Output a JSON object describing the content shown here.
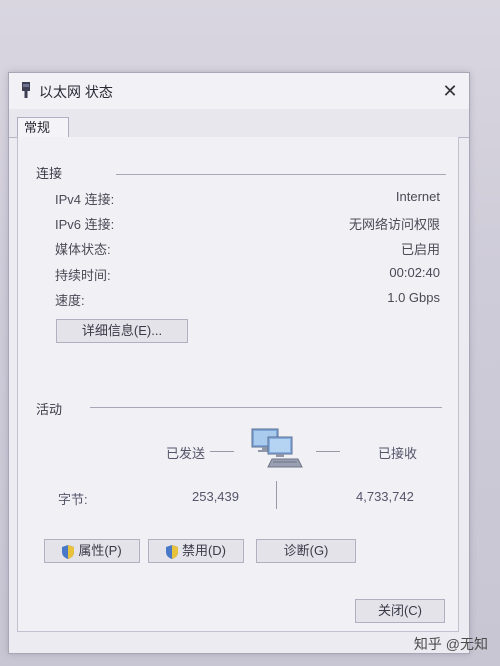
{
  "window": {
    "title": "以太网 状态",
    "close_glyph": "✕"
  },
  "tabs": [
    {
      "label": "常规"
    }
  ],
  "connection": {
    "section_title": "连接",
    "rows": [
      {
        "label": "IPv4 连接:",
        "value": "Internet"
      },
      {
        "label": "IPv6 连接:",
        "value": "无网络访问权限"
      },
      {
        "label": "媒体状态:",
        "value": "已启用"
      },
      {
        "label": "持续时间:",
        "value": "00:02:40"
      },
      {
        "label": "速度:",
        "value": "1.0 Gbps"
      }
    ],
    "details_button": "详细信息(E)..."
  },
  "activity": {
    "section_title": "活动",
    "sent_label": "已发送",
    "received_label": "已接收",
    "bytes_label": "字节:",
    "bytes_sent": "253,439",
    "bytes_received": "4,733,742",
    "icon": "network-computers-icon"
  },
  "buttons": {
    "properties": "属性(P)",
    "disable": "禁用(D)",
    "diagnose": "诊断(G)",
    "close": "关闭(C)"
  },
  "watermark": "知乎 @无知"
}
